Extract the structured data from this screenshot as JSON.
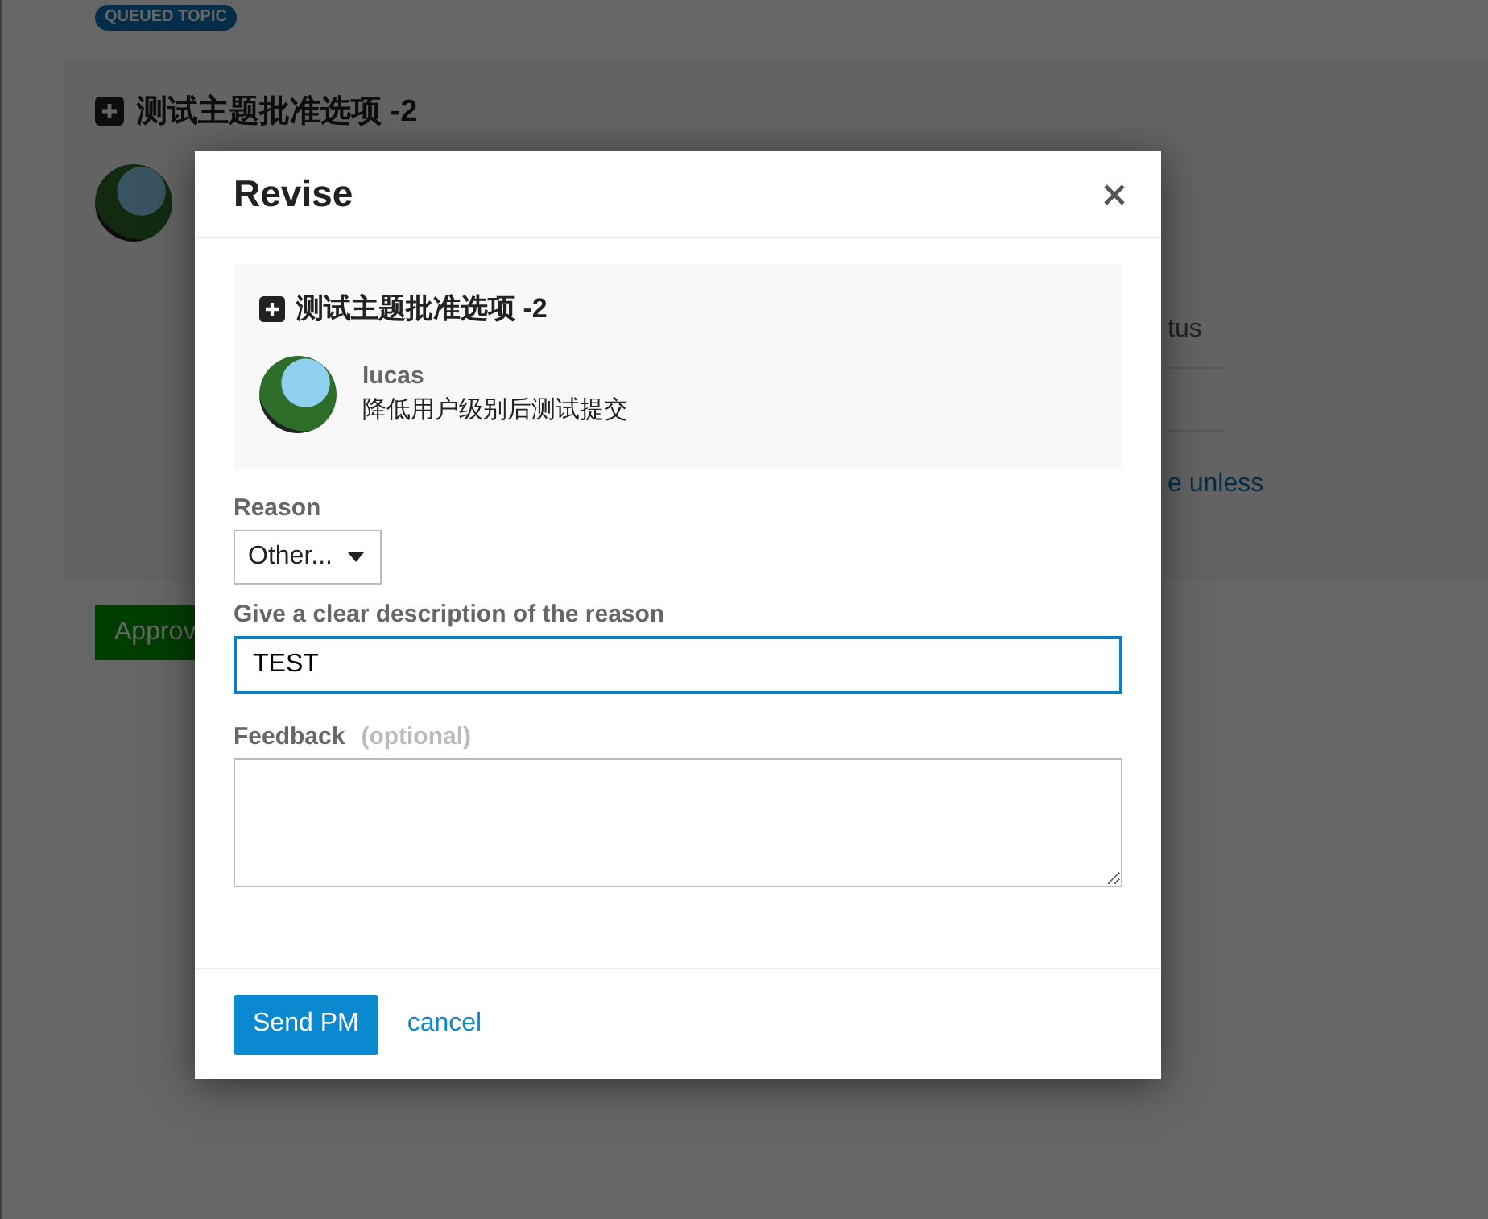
{
  "background": {
    "badge": "QUEUED TOPIC",
    "post": {
      "title": "测试主题批准选项 -2",
      "status_fragment": "tus",
      "link_fragment": "e unless"
    },
    "approve_button": "Approv"
  },
  "modal": {
    "title": "Revise",
    "post": {
      "title": "测试主题批准选项 -2",
      "username": "lucas",
      "body": "降低用户级别后测试提交"
    },
    "reason": {
      "label": "Reason",
      "value": "Other..."
    },
    "description": {
      "label": "Give a clear description of the reason",
      "value": "TEST",
      "focused": true
    },
    "feedback": {
      "label": "Feedback",
      "hint": "(optional)"
    },
    "buttons": {
      "send": "Send PM",
      "cancel": "cancel"
    }
  }
}
